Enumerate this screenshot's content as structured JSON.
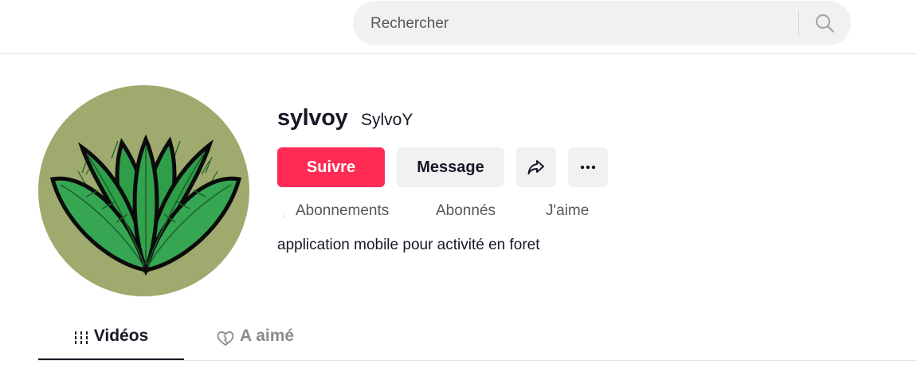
{
  "search": {
    "placeholder": "Rechercher",
    "icon": "search-icon"
  },
  "profile": {
    "username": "sylvoy",
    "nickname": "SylvoY",
    "bio": "application mobile pour activité en foret",
    "avatar_colors": {
      "background": "#9eaa6e",
      "leaf": "#2f9e48",
      "leaf_dark": "#1d5e2c",
      "outline": "#0b0b0b"
    }
  },
  "actions": {
    "follow_label": "Suivre",
    "message_label": "Message",
    "share_icon": "share-icon",
    "more_icon": "more-icon"
  },
  "stats": {
    "following_label": "Abonnements",
    "followers_label": "Abonnés",
    "likes_label": "J'aime"
  },
  "tabs": [
    {
      "label": "Vidéos",
      "icon": "grid-bars-icon",
      "active": true
    },
    {
      "label": "A aimé",
      "icon": "heart-icon",
      "active": false
    }
  ],
  "colors": {
    "accent": "#fe2c55",
    "text": "#161823",
    "muted": "#57585e",
    "button_bg": "#f1f1f2"
  }
}
